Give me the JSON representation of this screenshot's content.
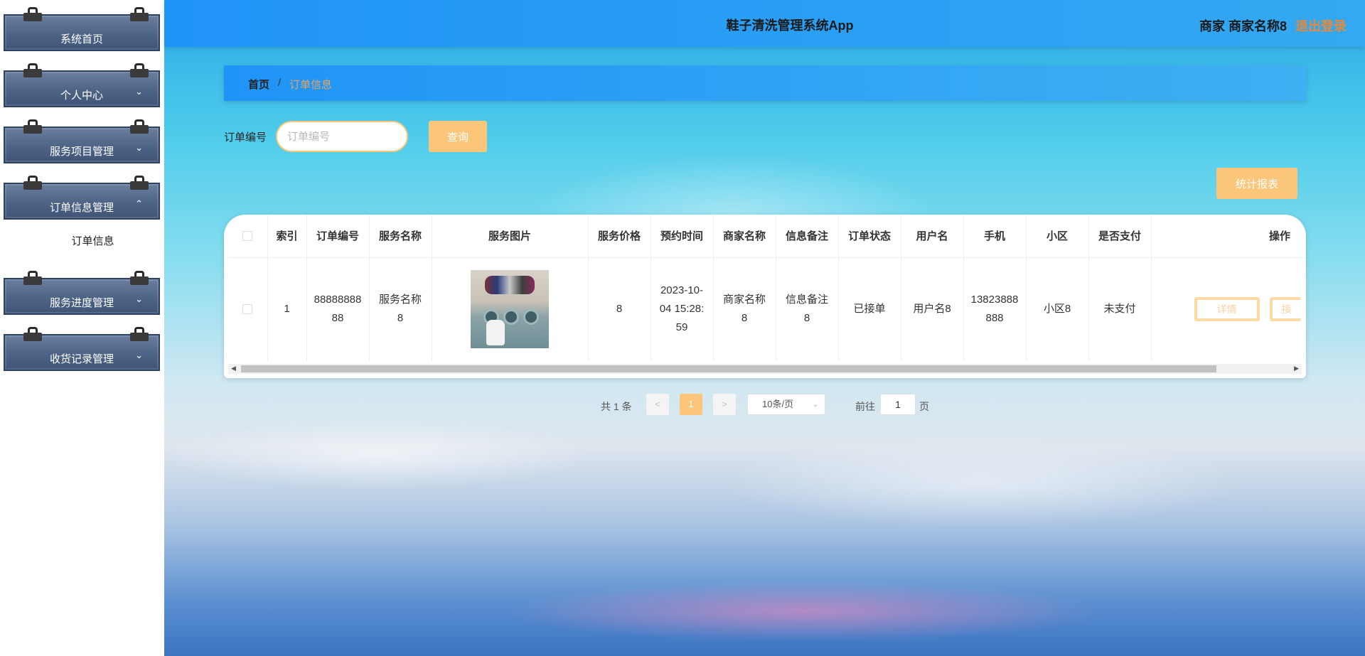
{
  "app": {
    "title": "鞋子清洗管理系统App",
    "user": "商家 商家名称8",
    "logout": "退出登录"
  },
  "sidebar": {
    "items": [
      {
        "label": "系统首页",
        "caret": ""
      },
      {
        "label": "个人中心",
        "caret": "⌄"
      },
      {
        "label": "服务项目管理",
        "caret": "⌄"
      },
      {
        "label": "订单信息管理",
        "caret": "⌃"
      },
      {
        "label": "服务进度管理",
        "caret": "⌄"
      },
      {
        "label": "收货记录管理",
        "caret": "⌄"
      }
    ],
    "sub_item": "订单信息"
  },
  "breadcrumb": {
    "home": "首页",
    "sep": "/",
    "current": "订单信息"
  },
  "search": {
    "label": "订单编号",
    "placeholder": "订单编号",
    "button": "查询"
  },
  "stats_button": "统计报表",
  "table": {
    "headers": [
      "索引",
      "订单编号",
      "服务名称",
      "服务图片",
      "服务价格",
      "预约时间",
      "商家名称",
      "信息备注",
      "订单状态",
      "用户名",
      "手机",
      "小区",
      "是否支付",
      "操作"
    ],
    "rows": [
      {
        "index": "1",
        "order_no": "8888888888",
        "service_name": "服务名称8",
        "price": "8",
        "appointment": "2023-10-04 15:28:59",
        "merchant": "商家名称8",
        "remark": "信息备注8",
        "status": "已接单",
        "username": "用户名8",
        "phone": "13823888888",
        "community": "小区8",
        "paid": "未支付",
        "op_detail": "详情",
        "op_second": "接"
      }
    ]
  },
  "pagination": {
    "total": "共 1 条",
    "prev": "<",
    "page": "1",
    "next": ">",
    "page_size": "10条/页",
    "goto": "前往",
    "goto_value": "1",
    "unit": "页"
  },
  "colors": {
    "accent": "#fcc67a",
    "topbar": "#1f94f7",
    "logout": "#e8883a",
    "sidebar": "#4e6486"
  },
  "icons": [
    "chevron-down-icon",
    "chevron-up-icon",
    "scroll-left-arrow-icon",
    "scroll-right-arrow-icon"
  ]
}
